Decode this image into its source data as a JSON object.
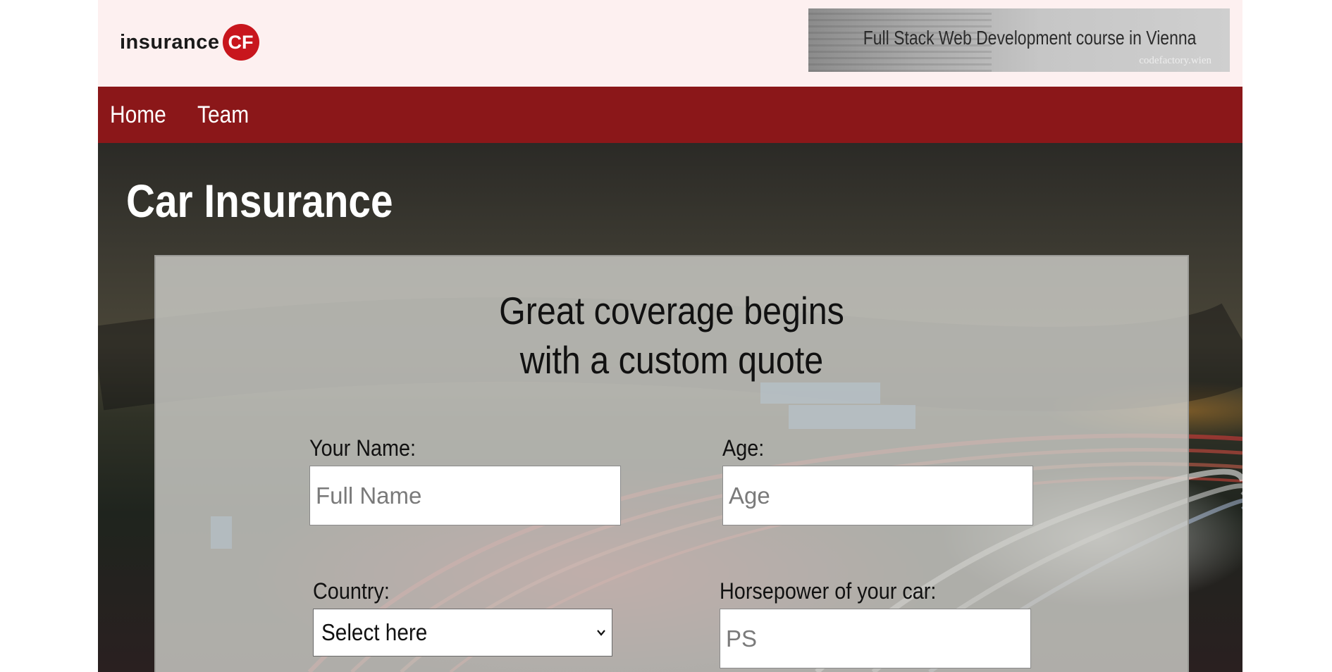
{
  "header": {
    "logo": {
      "text": "insurance",
      "badge": "CF"
    },
    "banner": {
      "title": "Full Stack Web Development course in Vienna",
      "subtitle": "codefactory.wien"
    }
  },
  "nav": {
    "items": [
      {
        "label": "Home"
      },
      {
        "label": "Team"
      }
    ]
  },
  "page": {
    "title": "Car Insurance"
  },
  "form": {
    "heading_line1": "Great coverage begins",
    "heading_line2": "with a custom quote",
    "name": {
      "label": "Your Name:",
      "placeholder": "Full Name"
    },
    "age": {
      "label": "Age:",
      "placeholder": "Age"
    },
    "country": {
      "label": "Country:",
      "selected": "Select here"
    },
    "horsepower": {
      "label": "Horsepower of your car:",
      "placeholder": "PS"
    }
  },
  "colors": {
    "nav_background": "#8b1719",
    "header_background": "#fdf0f0",
    "logo_badge": "#c8161d"
  },
  "icons": {
    "select_arrow": "chevron-down-icon"
  }
}
